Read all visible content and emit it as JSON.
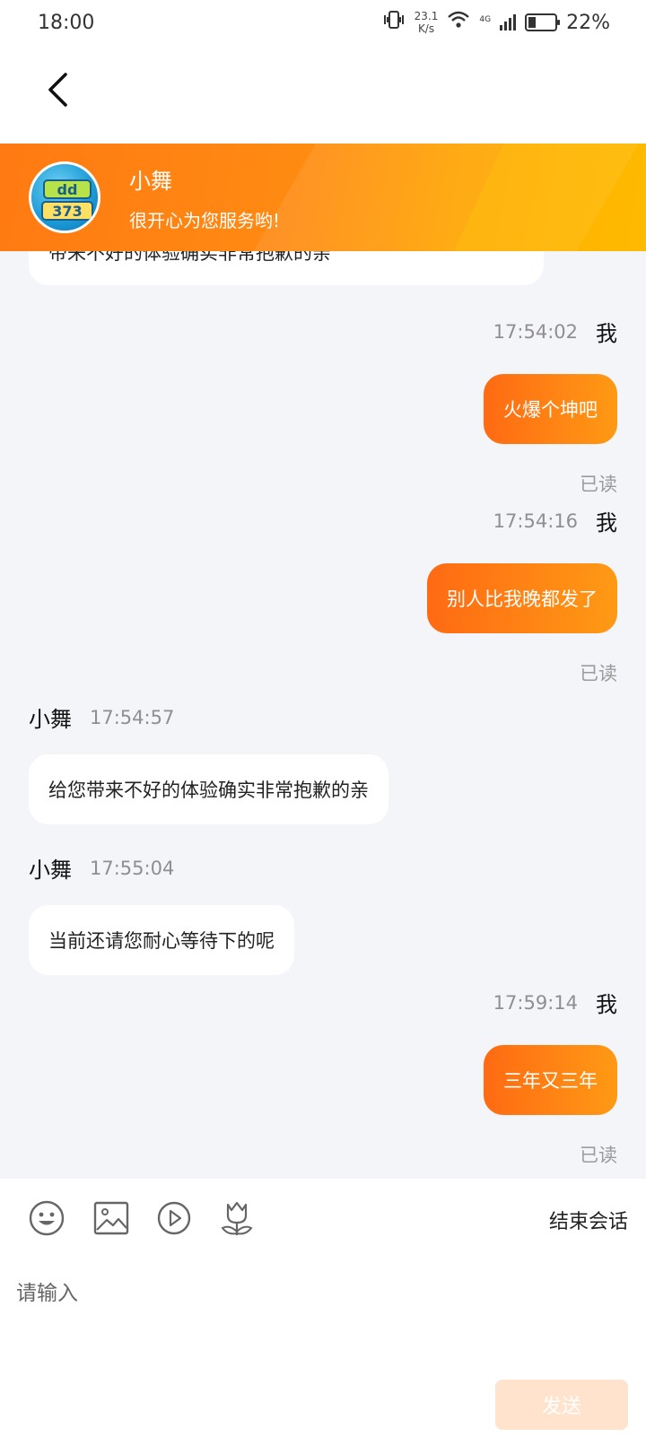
{
  "status_bar": {
    "time": "18:00",
    "net_speed_value": "23.1",
    "net_speed_unit": "K/s",
    "network_type": "4G",
    "battery_percent": "22%",
    "icons": [
      "vibrate-icon",
      "wifi-icon",
      "signal-icon",
      "battery-icon"
    ]
  },
  "nav": {
    "back_icon": "chevron-left-icon"
  },
  "agent": {
    "name": "小舞",
    "greeting": "很开心为您服务哟!"
  },
  "messages": [
    {
      "id": "m0",
      "direction": "in",
      "text": "带来不好的体验确实非常抱歉的亲",
      "truncated": true
    },
    {
      "id": "m1",
      "direction": "out",
      "sender": "我",
      "time": "17:54:02",
      "text": "火爆个坤吧",
      "status": "已读"
    },
    {
      "id": "m2",
      "direction": "out",
      "sender": "我",
      "time": "17:54:16",
      "text": "别人比我晚都发了",
      "status": "已读"
    },
    {
      "id": "m3",
      "direction": "in",
      "sender": "小舞",
      "time": "17:54:57",
      "text": "给您带来不好的体验确实非常抱歉的亲"
    },
    {
      "id": "m4",
      "direction": "in",
      "sender": "小舞",
      "time": "17:55:04",
      "text": "当前还请您耐心等待下的呢"
    },
    {
      "id": "m5",
      "direction": "out",
      "sender": "我",
      "time": "17:59:14",
      "text": "三年又三年",
      "status": "已读"
    }
  ],
  "toolbar": {
    "icons": [
      "emoji-icon",
      "image-icon",
      "video-icon",
      "flower-icon"
    ],
    "end_session_label": "结束会话"
  },
  "composer": {
    "placeholder": "请输入",
    "value": "",
    "send_label": "发送"
  },
  "colors": {
    "accent": "#ff7a12",
    "banner_end": "#ffb200",
    "send_disabled": "#ffe3cc",
    "background": "#f4f5f9"
  }
}
